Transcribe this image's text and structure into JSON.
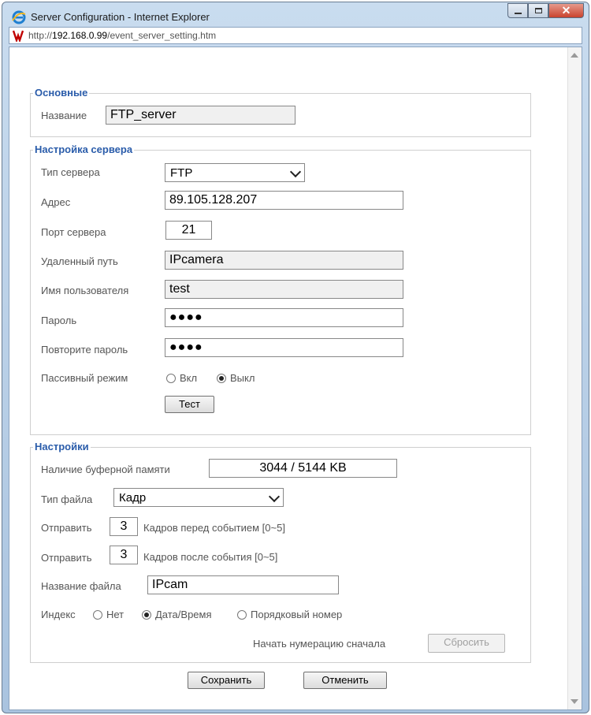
{
  "window": {
    "title": "Server Configuration - Internet Explorer",
    "url_prefix": "http://",
    "url_host": "192.168.0.99",
    "url_path": "/event_server_setting.htm"
  },
  "basic": {
    "legend": "Основные",
    "name_label": "Название",
    "name_value": "FTP_server"
  },
  "server": {
    "legend": "Настройка сервера",
    "type_label": "Тип сервера",
    "type_value": "FTP",
    "address_label": "Адрес",
    "address_value": "89.105.128.207",
    "port_label": "Порт сервера",
    "port_value": "21",
    "remote_path_label": "Удаленный путь",
    "remote_path_value": "IPcamera",
    "username_label": "Имя пользователя",
    "username_value": "test",
    "password_label": "Пароль",
    "password_value": "●●●●",
    "confirm_label": "Повторите пароль",
    "confirm_value": "●●●●",
    "passive_label": "Пассивный режим",
    "passive_on": "Вкл",
    "passive_off": "Выкл",
    "passive_selected": "off",
    "test_button": "Тест"
  },
  "settings": {
    "legend": "Настройки",
    "buffer_label": "Наличие буферной памяти",
    "buffer_value": "3044 / 5144 KB",
    "file_type_label": "Тип файла",
    "file_type_value": "Кадр",
    "send_label": "Отправить",
    "pre_frames": "3",
    "pre_text": "Кадров перед событием [0~5]",
    "post_frames": "3",
    "post_text": "Кадров после события [0~5]",
    "file_name_label": "Название файла",
    "file_name_value": "IPcam",
    "index_label": "Индекс",
    "index_none": "Нет",
    "index_datetime": "Дата/Время",
    "index_sequence": "Порядковый номер",
    "index_selected": "datetime",
    "reset_label": "Начать нумерацию сначала",
    "reset_button": "Сбросить"
  },
  "actions": {
    "save": "Сохранить",
    "cancel": "Отменить"
  },
  "colors": {
    "legend": "#2a5caa",
    "frame": "#b3cbe5"
  }
}
